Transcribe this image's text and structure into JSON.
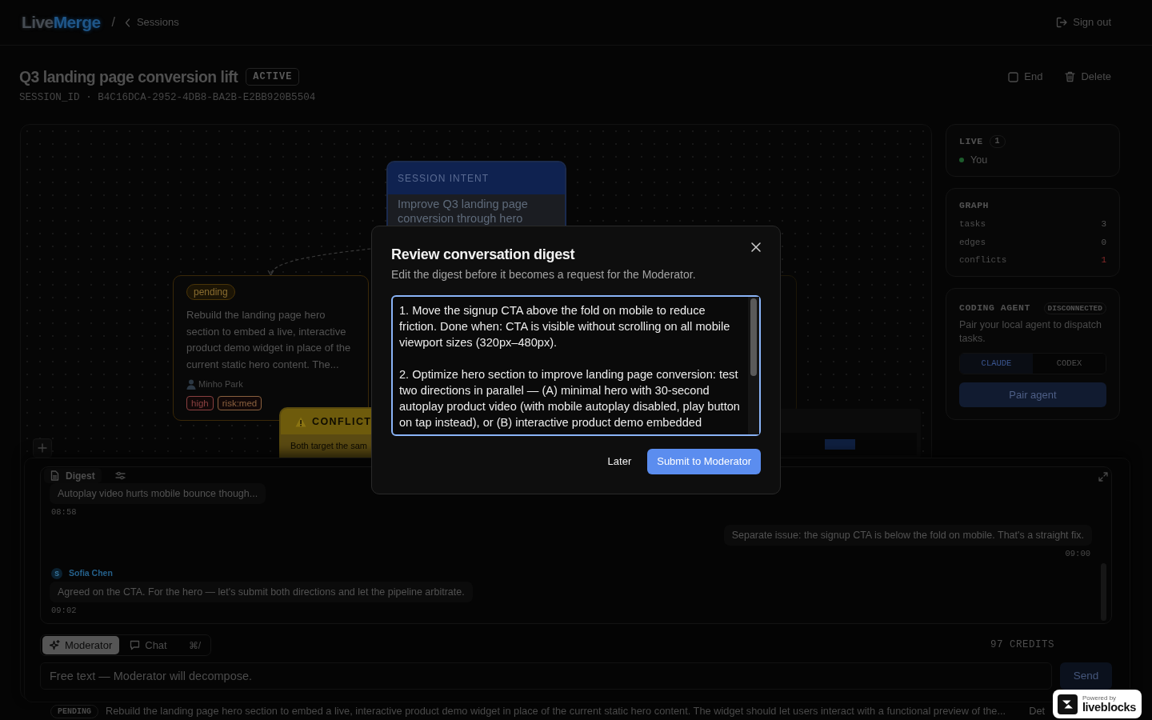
{
  "top_nav": {
    "logo_parts": [
      "Live",
      "Merge"
    ],
    "separator": "/",
    "back_link": "Sessions",
    "sign_out": "Sign out"
  },
  "header": {
    "title": "Q3 landing page conversion lift",
    "status": "ACTIVE",
    "session_id": "SESSION_ID · B4C16DCA-2952-4DB8-BA2B-E2BB920B5504",
    "actions": [
      {
        "kind": "end",
        "label": "End"
      },
      {
        "kind": "delete",
        "label": "Delete"
      }
    ]
  },
  "canvas": {
    "nodes": [
      {
        "kind": "intent",
        "header": "SESSION INTENT",
        "text": "Improve Q3 landing page conversion through hero"
      },
      {
        "kind": "task",
        "status": "pending",
        "text": "Rebuild the landing page hero section to embed a live, interactive product demo widget in place of the current static hero content. The...",
        "assignee": "Minho Park",
        "tags": [
          {
            "label": "high",
            "color": "#8a4040"
          },
          {
            "label": "risk:med",
            "color": "#8a603e"
          }
        ]
      },
      {
        "kind": "conflict",
        "header": "CONFLICT",
        "text": "Both target the sam"
      },
      {
        "kind": "task"
      }
    ],
    "edges": [
      {
        "kind": "dependency"
      }
    ]
  },
  "side_panel": {
    "live": {
      "title": "LIVE",
      "count": "1",
      "users": [
        {
          "name": "You",
          "color": "#1d5c2c"
        }
      ]
    },
    "graph": {
      "title": "GRAPH",
      "stats": [
        {
          "label": "tasks",
          "value": "3",
          "alert": false
        },
        {
          "label": "edges",
          "value": "0",
          "alert": false
        },
        {
          "label": "conflicts",
          "value": "1",
          "alert": true
        }
      ]
    },
    "coding_agent": {
      "title": "CODING AGENT",
      "status": "DISCONNECTED",
      "description": "Pair your local agent to dispatch tasks.",
      "agents": [
        {
          "label": "CLAUDE",
          "selected": true
        },
        {
          "label": "CODEX",
          "selected": false
        }
      ],
      "button": "Pair agent"
    }
  },
  "chat_dock": {
    "digest_chip": "Digest",
    "messages": [
      {
        "kind": "other",
        "text": "Autoplay video hurts mobile bounce though...",
        "time": "08:58"
      },
      {
        "kind": "own",
        "text": "Separate issue: the signup CTA is below the fold on mobile. That's a straight fix.",
        "time": "09:00"
      },
      {
        "kind": "other",
        "author": "Sofia Chen",
        "avatar": "S",
        "text": "Agreed on the CTA. For the hero — let's submit both directions and let the pipeline arbitrate.",
        "time": "09:02"
      }
    ],
    "modes": [
      {
        "kind": "moderator",
        "label": "Moderator",
        "selected": true
      },
      {
        "kind": "chat",
        "label": "Chat",
        "selected": false
      }
    ],
    "shortcut": "⌘/",
    "credits": "97 CREDITS",
    "input": {
      "placeholder": "Free text — Moderator will decompose."
    },
    "send": "Send"
  },
  "task_list": {
    "rows": [
      {
        "status": "PENDING",
        "text": "Rebuild the landing page hero section to embed a live, interactive product demo widget in place of the current static hero content. The widget should let users interact with a functional preview of the...",
        "action": "Det"
      }
    ]
  },
  "modal": {
    "title": "Review conversation digest",
    "subtitle": "Edit the digest before it becomes a request for the Moderator.",
    "digest": "1. Move the signup CTA above the fold on mobile to reduce friction. Done when: CTA is visible without scrolling on all mobile viewport sizes (320px–480px).\n\n2. Optimize hero section to improve landing page conversion: test two directions in parallel — (A) minimal hero with 30-second autoplay product video (with mobile autoplay disabled, play button on tap instead), or (B) interactive product demo embedded",
    "buttons": [
      {
        "kind": "secondary",
        "label": "Later"
      },
      {
        "kind": "primary",
        "label": "Submit to Moderator"
      }
    ]
  },
  "powered_badge": {
    "caption": "Powered by",
    "brand": "liveblocks"
  }
}
